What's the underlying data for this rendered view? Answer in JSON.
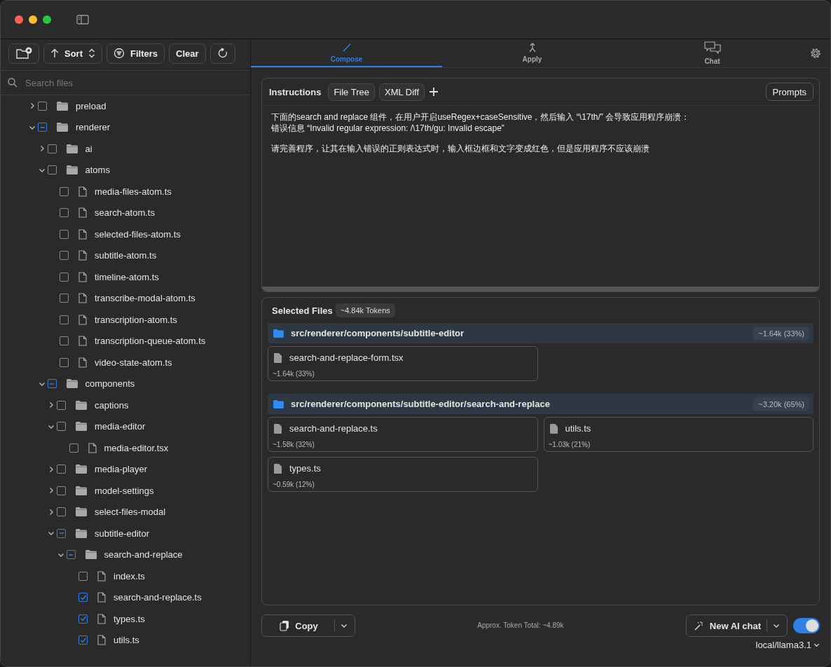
{
  "sidebar": {
    "toolbar": {
      "sort": "Sort",
      "filters": "Filters",
      "clear": "Clear"
    },
    "search": {
      "placeholder": "Search files"
    },
    "tree": [
      {
        "kind": "folder",
        "name": "preload",
        "expanded": false,
        "checked": false,
        "partial": false
      },
      {
        "kind": "folder",
        "name": "renderer",
        "expanded": true,
        "checked": false,
        "partial": true,
        "children": [
          {
            "kind": "folder",
            "name": "ai",
            "expanded": false,
            "checked": false,
            "partial": false
          },
          {
            "kind": "folder",
            "name": "atoms",
            "expanded": true,
            "checked": false,
            "partial": false,
            "children": [
              {
                "kind": "file",
                "name": "media-files-atom.ts",
                "checked": false
              },
              {
                "kind": "file",
                "name": "search-atom.ts",
                "checked": false
              },
              {
                "kind": "file",
                "name": "selected-files-atom.ts",
                "checked": false
              },
              {
                "kind": "file",
                "name": "subtitle-atom.ts",
                "checked": false
              },
              {
                "kind": "file",
                "name": "timeline-atom.ts",
                "checked": false
              },
              {
                "kind": "file",
                "name": "transcribe-modal-atom.ts",
                "checked": false
              },
              {
                "kind": "file",
                "name": "transcription-atom.ts",
                "checked": false
              },
              {
                "kind": "file",
                "name": "transcription-queue-atom.ts",
                "checked": false
              },
              {
                "kind": "file",
                "name": "video-state-atom.ts",
                "checked": false
              }
            ]
          },
          {
            "kind": "folder",
            "name": "components",
            "expanded": true,
            "checked": false,
            "partial": true,
            "children": [
              {
                "kind": "folder",
                "name": "captions",
                "expanded": false,
                "checked": false,
                "partial": false
              },
              {
                "kind": "folder",
                "name": "media-editor",
                "expanded": true,
                "checked": false,
                "partial": false,
                "children": [
                  {
                    "kind": "file",
                    "name": "media-editor.tsx",
                    "checked": false
                  }
                ]
              },
              {
                "kind": "folder",
                "name": "media-player",
                "expanded": false,
                "checked": false,
                "partial": false
              },
              {
                "kind": "folder",
                "name": "model-settings",
                "expanded": false,
                "checked": false,
                "partial": false
              },
              {
                "kind": "folder",
                "name": "select-files-modal",
                "expanded": false,
                "checked": false,
                "partial": false
              },
              {
                "kind": "folder",
                "name": "subtitle-editor",
                "expanded": true,
                "checked": false,
                "partial": true,
                "children": [
                  {
                    "kind": "folder",
                    "name": "search-and-replace",
                    "expanded": true,
                    "checked": false,
                    "partial": true,
                    "children": [
                      {
                        "kind": "file",
                        "name": "index.ts",
                        "checked": false
                      },
                      {
                        "kind": "file",
                        "name": "search-and-replace.ts",
                        "checked": true
                      },
                      {
                        "kind": "file",
                        "name": "types.ts",
                        "checked": true
                      },
                      {
                        "kind": "file",
                        "name": "utils.ts",
                        "checked": true
                      }
                    ]
                  }
                ]
              }
            ]
          }
        ]
      }
    ]
  },
  "tabs": [
    {
      "label": "Compose",
      "selected": true
    },
    {
      "label": "Apply",
      "selected": false
    },
    {
      "label": "Chat",
      "selected": false
    }
  ],
  "instructions": {
    "title": "Instructions",
    "buttons": [
      "File Tree",
      "XML Diff"
    ],
    "prompts": "Prompts",
    "paragraphs": [
      [
        "下面的search and replace 组件，在用户开启useRegex+caseSensitive，然后输入 “\\17th/” 会导致应用程序崩溃：",
        "错误信息 “Invalid regular expression: /\\17th/gu: Invalid escape”"
      ],
      [
        "请完善程序，让其在输入错误的正则表达式时，输入框边框和文字变成红色，但是应用程序不应该崩溃"
      ]
    ]
  },
  "selected_files": {
    "title": "Selected Files",
    "tokens": "~4.84k Tokens",
    "groups": [
      {
        "path": "src/renderer/components/subtitle-editor",
        "tokens": "~1.64k (33%)",
        "files": [
          {
            "name": "search-and-replace-form.tsx",
            "tokens": "~1.64k (33%)"
          }
        ]
      },
      {
        "path": "src/renderer/components/subtitle-editor/search-and-replace",
        "tokens": "~3.20k (65%)",
        "files": [
          {
            "name": "search-and-replace.ts",
            "tokens": "~1.58k (32%)"
          },
          {
            "name": "utils.ts",
            "tokens": "~1.03k (21%)"
          },
          {
            "name": "types.ts",
            "tokens": "~0.59k (12%)"
          }
        ]
      }
    ]
  },
  "footer": {
    "copy": "Copy",
    "total": "Approx. Token Total: ~4.89k",
    "new_chat": "New AI chat",
    "toggle_on": true,
    "model": "local/llama3.1"
  }
}
